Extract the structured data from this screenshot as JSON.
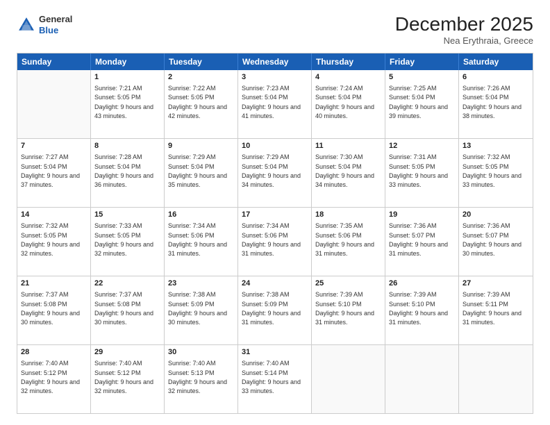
{
  "logo": {
    "general": "General",
    "blue": "Blue"
  },
  "title": "December 2025",
  "subtitle": "Nea Erythraia, Greece",
  "days_of_week": [
    "Sunday",
    "Monday",
    "Tuesday",
    "Wednesday",
    "Thursday",
    "Friday",
    "Saturday"
  ],
  "weeks": [
    [
      {
        "day": "",
        "sunrise": "",
        "sunset": "",
        "daylight": ""
      },
      {
        "day": "1",
        "sunrise": "Sunrise: 7:21 AM",
        "sunset": "Sunset: 5:05 PM",
        "daylight": "Daylight: 9 hours and 43 minutes."
      },
      {
        "day": "2",
        "sunrise": "Sunrise: 7:22 AM",
        "sunset": "Sunset: 5:05 PM",
        "daylight": "Daylight: 9 hours and 42 minutes."
      },
      {
        "day": "3",
        "sunrise": "Sunrise: 7:23 AM",
        "sunset": "Sunset: 5:04 PM",
        "daylight": "Daylight: 9 hours and 41 minutes."
      },
      {
        "day": "4",
        "sunrise": "Sunrise: 7:24 AM",
        "sunset": "Sunset: 5:04 PM",
        "daylight": "Daylight: 9 hours and 40 minutes."
      },
      {
        "day": "5",
        "sunrise": "Sunrise: 7:25 AM",
        "sunset": "Sunset: 5:04 PM",
        "daylight": "Daylight: 9 hours and 39 minutes."
      },
      {
        "day": "6",
        "sunrise": "Sunrise: 7:26 AM",
        "sunset": "Sunset: 5:04 PM",
        "daylight": "Daylight: 9 hours and 38 minutes."
      }
    ],
    [
      {
        "day": "7",
        "sunrise": "Sunrise: 7:27 AM",
        "sunset": "Sunset: 5:04 PM",
        "daylight": "Daylight: 9 hours and 37 minutes."
      },
      {
        "day": "8",
        "sunrise": "Sunrise: 7:28 AM",
        "sunset": "Sunset: 5:04 PM",
        "daylight": "Daylight: 9 hours and 36 minutes."
      },
      {
        "day": "9",
        "sunrise": "Sunrise: 7:29 AM",
        "sunset": "Sunset: 5:04 PM",
        "daylight": "Daylight: 9 hours and 35 minutes."
      },
      {
        "day": "10",
        "sunrise": "Sunrise: 7:29 AM",
        "sunset": "Sunset: 5:04 PM",
        "daylight": "Daylight: 9 hours and 34 minutes."
      },
      {
        "day": "11",
        "sunrise": "Sunrise: 7:30 AM",
        "sunset": "Sunset: 5:04 PM",
        "daylight": "Daylight: 9 hours and 34 minutes."
      },
      {
        "day": "12",
        "sunrise": "Sunrise: 7:31 AM",
        "sunset": "Sunset: 5:05 PM",
        "daylight": "Daylight: 9 hours and 33 minutes."
      },
      {
        "day": "13",
        "sunrise": "Sunrise: 7:32 AM",
        "sunset": "Sunset: 5:05 PM",
        "daylight": "Daylight: 9 hours and 33 minutes."
      }
    ],
    [
      {
        "day": "14",
        "sunrise": "Sunrise: 7:32 AM",
        "sunset": "Sunset: 5:05 PM",
        "daylight": "Daylight: 9 hours and 32 minutes."
      },
      {
        "day": "15",
        "sunrise": "Sunrise: 7:33 AM",
        "sunset": "Sunset: 5:05 PM",
        "daylight": "Daylight: 9 hours and 32 minutes."
      },
      {
        "day": "16",
        "sunrise": "Sunrise: 7:34 AM",
        "sunset": "Sunset: 5:06 PM",
        "daylight": "Daylight: 9 hours and 31 minutes."
      },
      {
        "day": "17",
        "sunrise": "Sunrise: 7:34 AM",
        "sunset": "Sunset: 5:06 PM",
        "daylight": "Daylight: 9 hours and 31 minutes."
      },
      {
        "day": "18",
        "sunrise": "Sunrise: 7:35 AM",
        "sunset": "Sunset: 5:06 PM",
        "daylight": "Daylight: 9 hours and 31 minutes."
      },
      {
        "day": "19",
        "sunrise": "Sunrise: 7:36 AM",
        "sunset": "Sunset: 5:07 PM",
        "daylight": "Daylight: 9 hours and 31 minutes."
      },
      {
        "day": "20",
        "sunrise": "Sunrise: 7:36 AM",
        "sunset": "Sunset: 5:07 PM",
        "daylight": "Daylight: 9 hours and 30 minutes."
      }
    ],
    [
      {
        "day": "21",
        "sunrise": "Sunrise: 7:37 AM",
        "sunset": "Sunset: 5:08 PM",
        "daylight": "Daylight: 9 hours and 30 minutes."
      },
      {
        "day": "22",
        "sunrise": "Sunrise: 7:37 AM",
        "sunset": "Sunset: 5:08 PM",
        "daylight": "Daylight: 9 hours and 30 minutes."
      },
      {
        "day": "23",
        "sunrise": "Sunrise: 7:38 AM",
        "sunset": "Sunset: 5:09 PM",
        "daylight": "Daylight: 9 hours and 30 minutes."
      },
      {
        "day": "24",
        "sunrise": "Sunrise: 7:38 AM",
        "sunset": "Sunset: 5:09 PM",
        "daylight": "Daylight: 9 hours and 31 minutes."
      },
      {
        "day": "25",
        "sunrise": "Sunrise: 7:39 AM",
        "sunset": "Sunset: 5:10 PM",
        "daylight": "Daylight: 9 hours and 31 minutes."
      },
      {
        "day": "26",
        "sunrise": "Sunrise: 7:39 AM",
        "sunset": "Sunset: 5:10 PM",
        "daylight": "Daylight: 9 hours and 31 minutes."
      },
      {
        "day": "27",
        "sunrise": "Sunrise: 7:39 AM",
        "sunset": "Sunset: 5:11 PM",
        "daylight": "Daylight: 9 hours and 31 minutes."
      }
    ],
    [
      {
        "day": "28",
        "sunrise": "Sunrise: 7:40 AM",
        "sunset": "Sunset: 5:12 PM",
        "daylight": "Daylight: 9 hours and 32 minutes."
      },
      {
        "day": "29",
        "sunrise": "Sunrise: 7:40 AM",
        "sunset": "Sunset: 5:12 PM",
        "daylight": "Daylight: 9 hours and 32 minutes."
      },
      {
        "day": "30",
        "sunrise": "Sunrise: 7:40 AM",
        "sunset": "Sunset: 5:13 PM",
        "daylight": "Daylight: 9 hours and 32 minutes."
      },
      {
        "day": "31",
        "sunrise": "Sunrise: 7:40 AM",
        "sunset": "Sunset: 5:14 PM",
        "daylight": "Daylight: 9 hours and 33 minutes."
      },
      {
        "day": "",
        "sunrise": "",
        "sunset": "",
        "daylight": ""
      },
      {
        "day": "",
        "sunrise": "",
        "sunset": "",
        "daylight": ""
      },
      {
        "day": "",
        "sunrise": "",
        "sunset": "",
        "daylight": ""
      }
    ]
  ]
}
